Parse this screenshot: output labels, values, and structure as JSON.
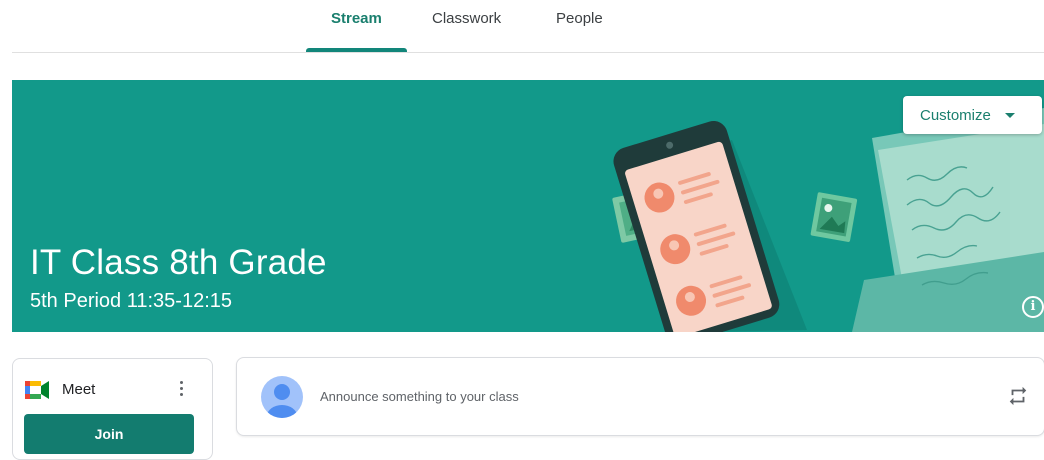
{
  "tabs": [
    {
      "label": "Stream",
      "active": true
    },
    {
      "label": "Classwork",
      "active": false
    },
    {
      "label": "People",
      "active": false
    }
  ],
  "banner": {
    "title": "IT Class 8th Grade",
    "subtitle": "5th Period 11:35-12:15",
    "customize_label": "Customize",
    "background_color": "#12998a",
    "info_icon": "info-icon"
  },
  "meet": {
    "label": "Meet",
    "join_label": "Join"
  },
  "announce": {
    "placeholder": "Announce something to your class"
  },
  "colors": {
    "accent": "#1a7f6e",
    "join_button": "#137c6f"
  }
}
